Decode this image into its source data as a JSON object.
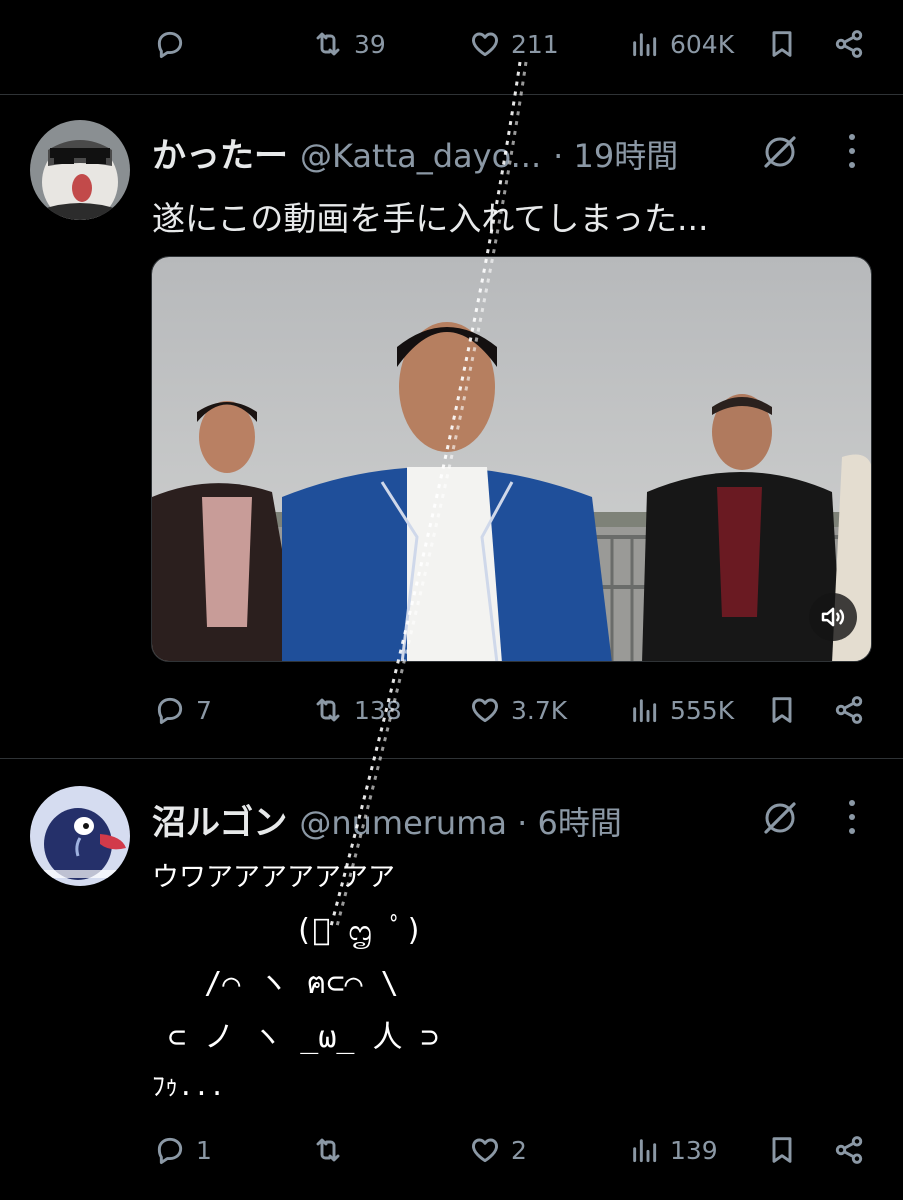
{
  "tweets": [
    {
      "actions": {
        "reply": "",
        "retweet": "39",
        "like": "211",
        "views": "604K"
      }
    },
    {
      "author_name": "かったー",
      "handle": "@Katta_dayo...",
      "time": "· 19時間",
      "text": "遂にこの動画を手に入れてしまった...",
      "media": {
        "type": "video",
        "muted": true
      },
      "actions": {
        "reply": "7",
        "retweet": "138",
        "like": "3.7K",
        "views": "555K"
      }
    },
    {
      "author_name": "沼ルゴン",
      "handle": "@numeruma · 6時間",
      "text_lines": [
        "ウワアアアアアアア",
        "        (ﾟ ᦗ ﾟ)",
        "   /⌒ ヽ ฅ⊂⌒ \\",
        " ⊂ ノ ヽ _ω_ 人 ⊃",
        "ﾌｩ..."
      ],
      "actions": {
        "reply": "1",
        "retweet": "",
        "like": "2",
        "views": "139"
      }
    }
  ],
  "icons": [
    "reply-icon",
    "retweet-icon",
    "like-icon",
    "views-icon",
    "bookmark-icon",
    "share-icon",
    "grok-icon",
    "more-icon",
    "volume-icon"
  ],
  "colors": {
    "background": "#000000",
    "text": "#e7e9ea",
    "muted": "#8b98a5",
    "divider": "#2f3336"
  }
}
